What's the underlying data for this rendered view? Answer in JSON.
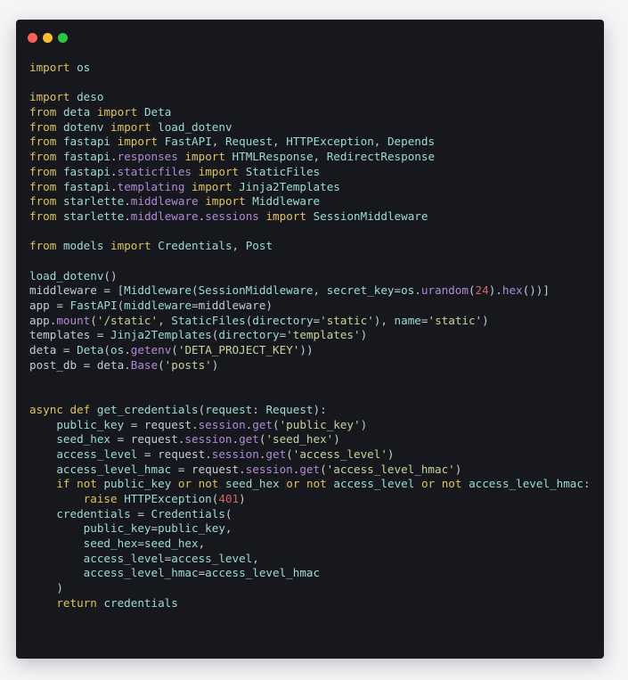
{
  "window": {
    "controls": [
      {
        "name": "close",
        "color": "#fe5f57"
      },
      {
        "name": "minimize",
        "color": "#febc2e"
      },
      {
        "name": "maximize",
        "color": "#28c840"
      }
    ]
  },
  "code": {
    "lines": [
      [
        [
          "kw",
          "import"
        ],
        [
          "plain",
          " "
        ],
        [
          "mod",
          "os"
        ]
      ],
      [],
      [
        [
          "kw",
          "import"
        ],
        [
          "plain",
          " "
        ],
        [
          "mod",
          "deso"
        ]
      ],
      [
        [
          "kw",
          "from"
        ],
        [
          "plain",
          " "
        ],
        [
          "mod",
          "deta"
        ],
        [
          "plain",
          " "
        ],
        [
          "kw",
          "import"
        ],
        [
          "plain",
          " "
        ],
        [
          "cls",
          "Deta"
        ]
      ],
      [
        [
          "kw",
          "from"
        ],
        [
          "plain",
          " "
        ],
        [
          "mod",
          "dotenv"
        ],
        [
          "plain",
          " "
        ],
        [
          "kw",
          "import"
        ],
        [
          "plain",
          " "
        ],
        [
          "cls",
          "load_dotenv"
        ]
      ],
      [
        [
          "kw",
          "from"
        ],
        [
          "plain",
          " "
        ],
        [
          "mod",
          "fastapi"
        ],
        [
          "plain",
          " "
        ],
        [
          "kw",
          "import"
        ],
        [
          "plain",
          " "
        ],
        [
          "cls",
          "FastAPI"
        ],
        [
          "plain",
          ", "
        ],
        [
          "cls",
          "Request"
        ],
        [
          "plain",
          ", "
        ],
        [
          "cls",
          "HTTPException"
        ],
        [
          "plain",
          ", "
        ],
        [
          "cls",
          "Depends"
        ]
      ],
      [
        [
          "kw",
          "from"
        ],
        [
          "plain",
          " "
        ],
        [
          "mod",
          "fastapi"
        ],
        [
          "plain",
          "."
        ],
        [
          "attr",
          "responses"
        ],
        [
          "plain",
          " "
        ],
        [
          "kw",
          "import"
        ],
        [
          "plain",
          " "
        ],
        [
          "cls",
          "HTMLResponse"
        ],
        [
          "plain",
          ", "
        ],
        [
          "cls",
          "RedirectResponse"
        ]
      ],
      [
        [
          "kw",
          "from"
        ],
        [
          "plain",
          " "
        ],
        [
          "mod",
          "fastapi"
        ],
        [
          "plain",
          "."
        ],
        [
          "attr",
          "staticfiles"
        ],
        [
          "plain",
          " "
        ],
        [
          "kw",
          "import"
        ],
        [
          "plain",
          " "
        ],
        [
          "cls",
          "StaticFiles"
        ]
      ],
      [
        [
          "kw",
          "from"
        ],
        [
          "plain",
          " "
        ],
        [
          "mod",
          "fastapi"
        ],
        [
          "plain",
          "."
        ],
        [
          "attr",
          "templating"
        ],
        [
          "plain",
          " "
        ],
        [
          "kw",
          "import"
        ],
        [
          "plain",
          " "
        ],
        [
          "cls",
          "Jinja2Templates"
        ]
      ],
      [
        [
          "kw",
          "from"
        ],
        [
          "plain",
          " "
        ],
        [
          "mod",
          "starlette"
        ],
        [
          "plain",
          "."
        ],
        [
          "attr",
          "middleware"
        ],
        [
          "plain",
          " "
        ],
        [
          "kw",
          "import"
        ],
        [
          "plain",
          " "
        ],
        [
          "cls",
          "Middleware"
        ]
      ],
      [
        [
          "kw",
          "from"
        ],
        [
          "plain",
          " "
        ],
        [
          "mod",
          "starlette"
        ],
        [
          "plain",
          "."
        ],
        [
          "attr",
          "middleware"
        ],
        [
          "plain",
          "."
        ],
        [
          "attr",
          "sessions"
        ],
        [
          "plain",
          " "
        ],
        [
          "kw",
          "import"
        ],
        [
          "plain",
          " "
        ],
        [
          "cls",
          "SessionMiddleware"
        ]
      ],
      [],
      [
        [
          "kw",
          "from"
        ],
        [
          "plain",
          " "
        ],
        [
          "mod",
          "models"
        ],
        [
          "plain",
          " "
        ],
        [
          "kw",
          "import"
        ],
        [
          "plain",
          " "
        ],
        [
          "cls",
          "Credentials"
        ],
        [
          "plain",
          ", "
        ],
        [
          "cls",
          "Post"
        ]
      ],
      [],
      [
        [
          "cls",
          "load_dotenv"
        ],
        [
          "plain",
          "()"
        ]
      ],
      [
        [
          "plain",
          "middleware = ["
        ],
        [
          "cls",
          "Middleware"
        ],
        [
          "plain",
          "("
        ],
        [
          "cls",
          "SessionMiddleware"
        ],
        [
          "plain",
          ", "
        ],
        [
          "cls",
          "secret_key"
        ],
        [
          "plain",
          "="
        ],
        [
          "mod",
          "os"
        ],
        [
          "plain",
          "."
        ],
        [
          "attr",
          "urandom"
        ],
        [
          "plain",
          "("
        ],
        [
          "num",
          "24"
        ],
        [
          "plain",
          ")."
        ],
        [
          "attr",
          "hex"
        ],
        [
          "plain",
          "())]"
        ]
      ],
      [
        [
          "plain",
          "app = "
        ],
        [
          "cls",
          "FastAPI"
        ],
        [
          "plain",
          "("
        ],
        [
          "cls",
          "middleware"
        ],
        [
          "plain",
          "=middleware)"
        ]
      ],
      [
        [
          "plain",
          "app."
        ],
        [
          "attr",
          "mount"
        ],
        [
          "plain",
          "("
        ],
        [
          "str",
          "'/static'"
        ],
        [
          "plain",
          ", "
        ],
        [
          "cls",
          "StaticFiles"
        ],
        [
          "plain",
          "("
        ],
        [
          "cls",
          "directory"
        ],
        [
          "plain",
          "="
        ],
        [
          "str",
          "'static'"
        ],
        [
          "plain",
          "), "
        ],
        [
          "cls",
          "name"
        ],
        [
          "plain",
          "="
        ],
        [
          "str",
          "'static'"
        ],
        [
          "plain",
          ")"
        ]
      ],
      [
        [
          "plain",
          "templates = "
        ],
        [
          "cls",
          "Jinja2Templates"
        ],
        [
          "plain",
          "("
        ],
        [
          "cls",
          "directory"
        ],
        [
          "plain",
          "="
        ],
        [
          "str",
          "'templates'"
        ],
        [
          "plain",
          ")"
        ]
      ],
      [
        [
          "plain",
          "deta = "
        ],
        [
          "cls",
          "Deta"
        ],
        [
          "plain",
          "("
        ],
        [
          "mod",
          "os"
        ],
        [
          "plain",
          "."
        ],
        [
          "attr",
          "getenv"
        ],
        [
          "plain",
          "("
        ],
        [
          "str",
          "'DETA_PROJECT_KEY'"
        ],
        [
          "plain",
          "))"
        ]
      ],
      [
        [
          "plain",
          "post_db = deta."
        ],
        [
          "attr",
          "Base"
        ],
        [
          "plain",
          "("
        ],
        [
          "str",
          "'posts'"
        ],
        [
          "plain",
          ")"
        ]
      ],
      [],
      [],
      [
        [
          "kw",
          "async"
        ],
        [
          "plain",
          " "
        ],
        [
          "kw",
          "def"
        ],
        [
          "plain",
          " "
        ],
        [
          "cls",
          "get_credentials"
        ],
        [
          "plain",
          "("
        ],
        [
          "cls",
          "request"
        ],
        [
          "plain",
          ": "
        ],
        [
          "cls",
          "Request"
        ],
        [
          "plain",
          "):"
        ]
      ],
      [
        [
          "plain",
          "    "
        ],
        [
          "cls",
          "public_key"
        ],
        [
          "plain",
          " = request."
        ],
        [
          "attr",
          "session"
        ],
        [
          "plain",
          "."
        ],
        [
          "attr",
          "get"
        ],
        [
          "plain",
          "("
        ],
        [
          "str",
          "'public_key'"
        ],
        [
          "plain",
          ")"
        ]
      ],
      [
        [
          "plain",
          "    "
        ],
        [
          "cls",
          "seed_hex"
        ],
        [
          "plain",
          " = request."
        ],
        [
          "attr",
          "session"
        ],
        [
          "plain",
          "."
        ],
        [
          "attr",
          "get"
        ],
        [
          "plain",
          "("
        ],
        [
          "str",
          "'seed_hex'"
        ],
        [
          "plain",
          ")"
        ]
      ],
      [
        [
          "plain",
          "    "
        ],
        [
          "cls",
          "access_level"
        ],
        [
          "plain",
          " = request."
        ],
        [
          "attr",
          "session"
        ],
        [
          "plain",
          "."
        ],
        [
          "attr",
          "get"
        ],
        [
          "plain",
          "("
        ],
        [
          "str",
          "'access_level'"
        ],
        [
          "plain",
          ")"
        ]
      ],
      [
        [
          "plain",
          "    "
        ],
        [
          "cls",
          "access_level_hmac"
        ],
        [
          "plain",
          " = request."
        ],
        [
          "attr",
          "session"
        ],
        [
          "plain",
          "."
        ],
        [
          "attr",
          "get"
        ],
        [
          "plain",
          "("
        ],
        [
          "str",
          "'access_level_hmac'"
        ],
        [
          "plain",
          ")"
        ]
      ],
      [
        [
          "plain",
          "    "
        ],
        [
          "kw",
          "if"
        ],
        [
          "plain",
          " "
        ],
        [
          "kw",
          "not"
        ],
        [
          "plain",
          " "
        ],
        [
          "cls",
          "public_key"
        ],
        [
          "plain",
          " "
        ],
        [
          "kw",
          "or"
        ],
        [
          "plain",
          " "
        ],
        [
          "kw",
          "not"
        ],
        [
          "plain",
          " "
        ],
        [
          "cls",
          "seed_hex"
        ],
        [
          "plain",
          " "
        ],
        [
          "kw",
          "or"
        ],
        [
          "plain",
          " "
        ],
        [
          "kw",
          "not"
        ],
        [
          "plain",
          " "
        ],
        [
          "cls",
          "access_level"
        ],
        [
          "plain",
          " "
        ],
        [
          "kw",
          "or"
        ],
        [
          "plain",
          " "
        ],
        [
          "kw",
          "not"
        ],
        [
          "plain",
          " "
        ],
        [
          "cls",
          "access_level_hmac"
        ],
        [
          "plain",
          ":"
        ]
      ],
      [
        [
          "plain",
          "        "
        ],
        [
          "kw",
          "raise"
        ],
        [
          "plain",
          " "
        ],
        [
          "cls",
          "HTTPException"
        ],
        [
          "plain",
          "("
        ],
        [
          "num",
          "401"
        ],
        [
          "plain",
          ")"
        ]
      ],
      [
        [
          "plain",
          "    "
        ],
        [
          "cls",
          "credentials"
        ],
        [
          "plain",
          " = "
        ],
        [
          "cls",
          "Credentials"
        ],
        [
          "plain",
          "("
        ]
      ],
      [
        [
          "plain",
          "        "
        ],
        [
          "cls",
          "public_key"
        ],
        [
          "plain",
          "="
        ],
        [
          "cls",
          "public_key"
        ],
        [
          "plain",
          ","
        ]
      ],
      [
        [
          "plain",
          "        "
        ],
        [
          "cls",
          "seed_hex"
        ],
        [
          "plain",
          "="
        ],
        [
          "cls",
          "seed_hex"
        ],
        [
          "plain",
          ","
        ]
      ],
      [
        [
          "plain",
          "        "
        ],
        [
          "cls",
          "access_level"
        ],
        [
          "plain",
          "="
        ],
        [
          "cls",
          "access_level"
        ],
        [
          "plain",
          ","
        ]
      ],
      [
        [
          "plain",
          "        "
        ],
        [
          "cls",
          "access_level_hmac"
        ],
        [
          "plain",
          "="
        ],
        [
          "cls",
          "access_level_hmac"
        ]
      ],
      [
        [
          "plain",
          "    )"
        ]
      ],
      [
        [
          "plain",
          "    "
        ],
        [
          "kw",
          "return"
        ],
        [
          "plain",
          " "
        ],
        [
          "cls",
          "credentials"
        ]
      ]
    ]
  }
}
